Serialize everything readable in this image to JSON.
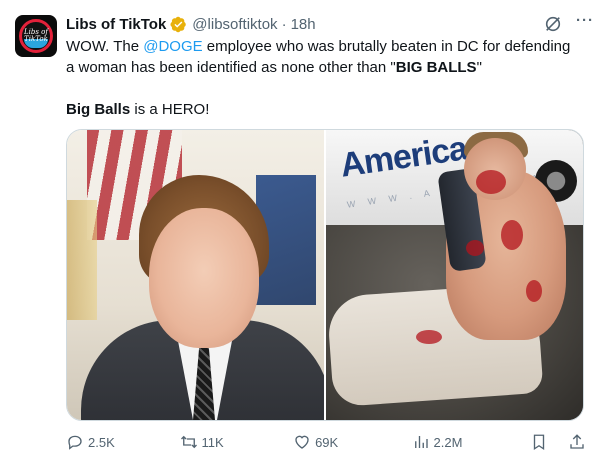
{
  "author": {
    "display_name": "Libs of TikTok",
    "handle": "@libsoftiktok",
    "separator": "·",
    "time": "18h",
    "avatar_text": "Libs of TikTok",
    "verified_color": "#e8b10b"
  },
  "tweet": {
    "line1_pre": "WOW. The ",
    "line1_mention": "@DOGE",
    "line1_post": " employee who was brutally beaten in DC for defending",
    "line2_pre": "a woman has been identified as none other than \"",
    "line2_bold": "BIG BALLS",
    "line2_post": "\"",
    "line3_bold": "Big Balls",
    "line3_post": " is a HERO!"
  },
  "media": {
    "right_van_text": "America",
    "right_van_subtext": "W W W . A M E R I C A"
  },
  "actions": {
    "replies": "2.5K",
    "retweets": "11K",
    "likes": "69K",
    "views": "2.2M"
  },
  "colors": {
    "accent": "#1d9bf0",
    "muted": "#536471",
    "text": "#0f1419"
  }
}
